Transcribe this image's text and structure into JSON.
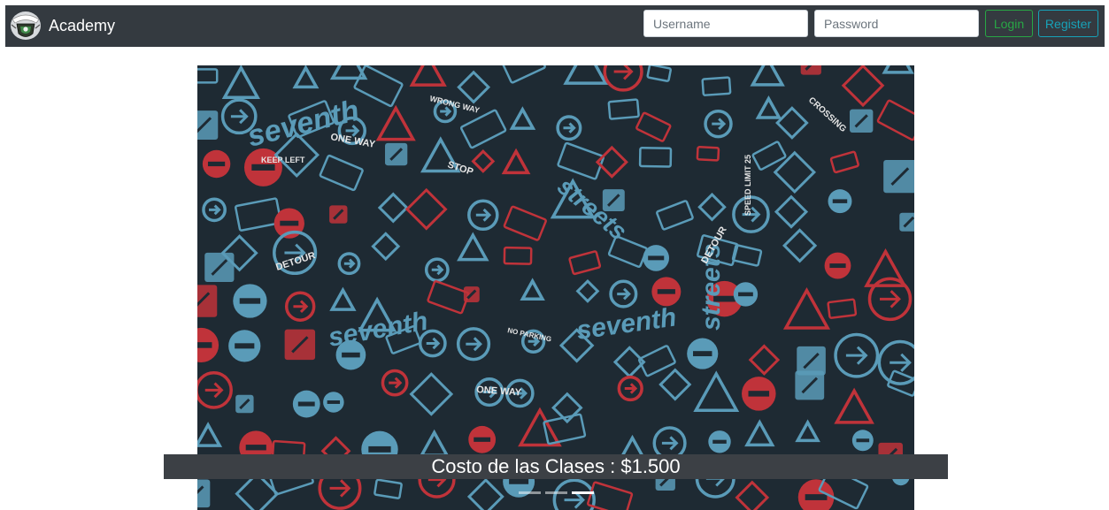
{
  "navbar": {
    "brand": "Academy",
    "username_placeholder": "Username",
    "password_placeholder": "Password",
    "login_label": "Login",
    "register_label": "Register",
    "logo_icon": "academy-crest-icon"
  },
  "carousel": {
    "caption": "Costo de las Clases : $1.500",
    "indicator_count": 3,
    "active_indicator": 3,
    "background_color": "#1e2a33",
    "sign_colors": [
      "#5a9bb8",
      "#c0333a",
      "#e6e6e6"
    ],
    "wordmarks": [
      "seventh",
      "streets"
    ],
    "sign_text": [
      "ONE WAY",
      "DETOUR",
      "STOP",
      "KEEP LEFT",
      "WRONG WAY",
      "SPEED LIMIT 25",
      "CROSSING",
      "NO PARKING"
    ]
  },
  "colors": {
    "navbar": "#343a40",
    "login": "#28a745",
    "register": "#17a2b8",
    "caption_bar": "#3c4045"
  }
}
